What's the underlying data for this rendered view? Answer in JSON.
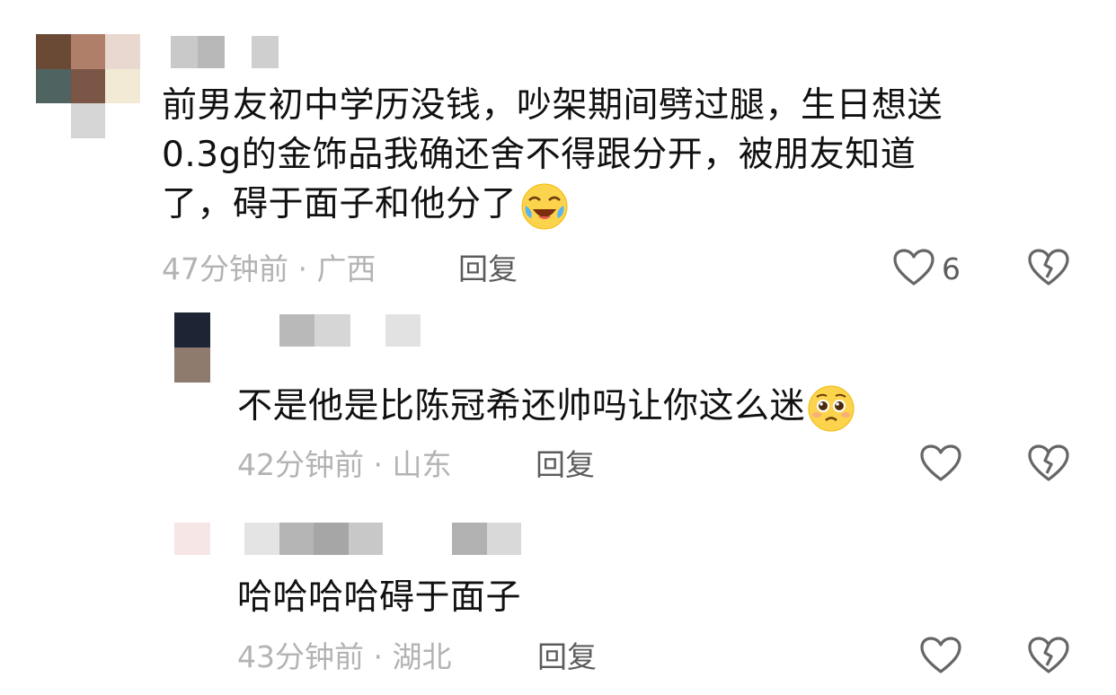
{
  "comments": [
    {
      "text_lines": [
        "前男友初中学历没钱，吵架期间劈过腿，生日想送",
        "0.3g的金饰品我确还舍不得跟分开，被朋友知道",
        "了，碍于面子和他分了"
      ],
      "emoji": "crying-laughing-emoji",
      "time": "47分钟前",
      "sep": "·",
      "location": "广西",
      "reply_label": "回复",
      "likes": "6",
      "icon_like": "heart-outline-icon",
      "icon_dislike": "broken-heart-icon"
    },
    {
      "text": "不是他是比陈冠希还帅吗让你这么迷",
      "emoji": "pleading-face-emoji",
      "time": "42分钟前",
      "sep": "·",
      "location": "山东",
      "reply_label": "回复",
      "likes": "",
      "icon_like": "heart-outline-icon",
      "icon_dislike": "broken-heart-icon"
    },
    {
      "text": "哈哈哈哈碍于面子",
      "time": "43分钟前",
      "sep": "·",
      "location": "湖北",
      "reply_label": "回复",
      "likes": "",
      "icon_like": "heart-outline-icon",
      "icon_dislike": "broken-heart-icon"
    }
  ],
  "colors": {
    "text": "#111111",
    "meta": "#b3b3b3",
    "reply": "#5c5c5c",
    "icon": "#666666"
  }
}
